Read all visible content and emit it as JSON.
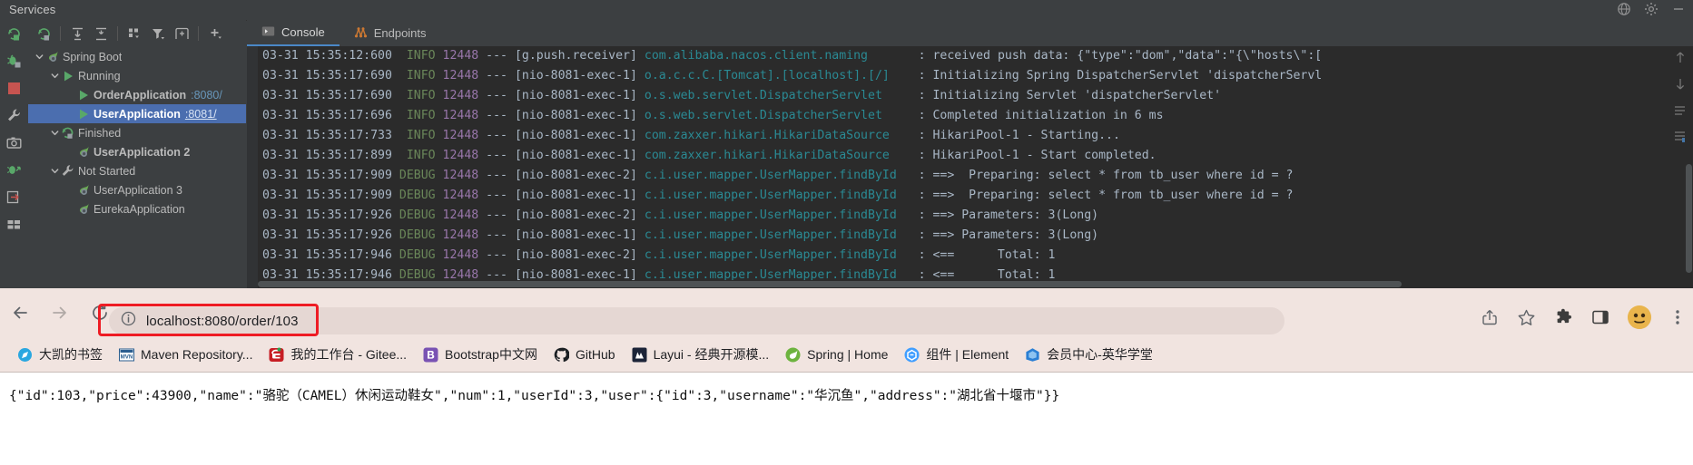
{
  "ide": {
    "window_title": "Services",
    "tree_toolbar_icons": [
      "rerun-icon",
      "expand-all-icon",
      "collapse-all-icon",
      "group-by-icon",
      "filter-icon",
      "add-tab-icon",
      "add-service-icon"
    ],
    "left_strip_icons": [
      "rerun-icon",
      "debug-icon",
      "stop-icon",
      "settings-wrench-icon",
      "camera-icon",
      "debug-attach-icon",
      "export-icon",
      "layout-icon"
    ],
    "tabs": [
      {
        "label": "Console",
        "icon": "console-icon",
        "active": true
      },
      {
        "label": "Endpoints",
        "icon": "endpoints-icon",
        "active": false
      }
    ],
    "tree": [
      {
        "label": "Spring Boot",
        "icon": "spring-icon",
        "indent": 0,
        "arrow": "down",
        "bold": false,
        "selected": false,
        "port": ""
      },
      {
        "label": "Running",
        "icon": "run-icon",
        "indent": 1,
        "arrow": "down",
        "bold": false,
        "selected": false,
        "port": ""
      },
      {
        "label": "OrderApplication",
        "icon": "run-icon",
        "indent": 2,
        "arrow": "none",
        "bold": true,
        "selected": false,
        "port": ":8080/"
      },
      {
        "label": "UserApplication",
        "icon": "run-icon",
        "indent": 2,
        "arrow": "none",
        "bold": true,
        "selected": true,
        "port": ":8081/"
      },
      {
        "label": "Finished",
        "icon": "rerun-icon",
        "indent": 1,
        "arrow": "down",
        "bold": false,
        "selected": false,
        "port": ""
      },
      {
        "label": "UserApplication 2",
        "icon": "spring-icon",
        "indent": 2,
        "arrow": "none",
        "bold": true,
        "selected": false,
        "port": ""
      },
      {
        "label": "Not Started",
        "icon": "wrench-icon",
        "indent": 1,
        "arrow": "down",
        "bold": false,
        "selected": false,
        "port": ""
      },
      {
        "label": "UserApplication 3",
        "icon": "spring-icon",
        "indent": 2,
        "arrow": "none",
        "bold": false,
        "selected": false,
        "port": ""
      },
      {
        "label": "EurekaApplication",
        "icon": "spring-icon",
        "indent": 2,
        "arrow": "none",
        "bold": false,
        "selected": false,
        "port": ""
      }
    ],
    "log_lines": [
      {
        "date": "03-31 15:35:12:600",
        "level": "INFO",
        "pid": "12448",
        "thread": "[g.push.receiver]",
        "logger": "com.alibaba.nacos.client.naming",
        "msg": "received push data: {\"type\":\"dom\",\"data\":\"{\\\"hosts\\\":["
      },
      {
        "date": "03-31 15:35:17:690",
        "level": "INFO",
        "pid": "12448",
        "thread": "[nio-8081-exec-1]",
        "logger": "o.a.c.c.C.[Tomcat].[localhost].[/]",
        "msg": "Initializing Spring DispatcherServlet 'dispatcherServl"
      },
      {
        "date": "03-31 15:35:17:690",
        "level": "INFO",
        "pid": "12448",
        "thread": "[nio-8081-exec-1]",
        "logger": "o.s.web.servlet.DispatcherServlet",
        "msg": "Initializing Servlet 'dispatcherServlet'"
      },
      {
        "date": "03-31 15:35:17:696",
        "level": "INFO",
        "pid": "12448",
        "thread": "[nio-8081-exec-1]",
        "logger": "o.s.web.servlet.DispatcherServlet",
        "msg": "Completed initialization in 6 ms"
      },
      {
        "date": "03-31 15:35:17:733",
        "level": "INFO",
        "pid": "12448",
        "thread": "[nio-8081-exec-1]",
        "logger": "com.zaxxer.hikari.HikariDataSource",
        "msg": "HikariPool-1 - Starting..."
      },
      {
        "date": "03-31 15:35:17:899",
        "level": "INFO",
        "pid": "12448",
        "thread": "[nio-8081-exec-1]",
        "logger": "com.zaxxer.hikari.HikariDataSource",
        "msg": "HikariPool-1 - Start completed."
      },
      {
        "date": "03-31 15:35:17:909",
        "level": "DEBUG",
        "pid": "12448",
        "thread": "[nio-8081-exec-2]",
        "logger": "c.i.user.mapper.UserMapper.findById",
        "msg": "==>  Preparing: select * from tb_user where id = ?"
      },
      {
        "date": "03-31 15:35:17:909",
        "level": "DEBUG",
        "pid": "12448",
        "thread": "[nio-8081-exec-1]",
        "logger": "c.i.user.mapper.UserMapper.findById",
        "msg": "==>  Preparing: select * from tb_user where id = ?"
      },
      {
        "date": "03-31 15:35:17:926",
        "level": "DEBUG",
        "pid": "12448",
        "thread": "[nio-8081-exec-2]",
        "logger": "c.i.user.mapper.UserMapper.findById",
        "msg": "==> Parameters: 3(Long)"
      },
      {
        "date": "03-31 15:35:17:926",
        "level": "DEBUG",
        "pid": "12448",
        "thread": "[nio-8081-exec-1]",
        "logger": "c.i.user.mapper.UserMapper.findById",
        "msg": "==> Parameters: 3(Long)"
      },
      {
        "date": "03-31 15:35:17:946",
        "level": "DEBUG",
        "pid": "12448",
        "thread": "[nio-8081-exec-2]",
        "logger": "c.i.user.mapper.UserMapper.findById",
        "msg": "<==      Total: 1"
      },
      {
        "date": "03-31 15:35:17:946",
        "level": "DEBUG",
        "pid": "12448",
        "thread": "[nio-8081-exec-1]",
        "logger": "c.i.user.mapper.UserMapper.findById",
        "msg": "<==      Total: 1"
      }
    ]
  },
  "browser": {
    "nav": {
      "back_icon": "back-arrow-icon",
      "forward_icon": "forward-arrow-icon",
      "reload_icon": "reload-icon",
      "info_icon": "site-info-icon",
      "url": "localhost:8080/order/103",
      "url_host": "localhost:8080",
      "url_path": "/order/103",
      "highlight_color": "#ee1c24",
      "right_icons": [
        "share-icon",
        "bookmark-star-icon",
        "extensions-puzzle-icon",
        "side-panel-icon",
        "profile-avatar",
        "more-menu-icon"
      ]
    },
    "bookmarks": [
      {
        "label": "大凯的书签",
        "icon": "compass-icon"
      },
      {
        "label": "Maven Repository...",
        "icon": "maven-icon"
      },
      {
        "label": "我的工作台 - Gitee...",
        "icon": "gitee-icon"
      },
      {
        "label": "Bootstrap中文网",
        "icon": "bootstrap-icon"
      },
      {
        "label": "GitHub",
        "icon": "github-icon"
      },
      {
        "label": "Layui - 经典开源模...",
        "icon": "layui-icon"
      },
      {
        "label": "Spring | Home",
        "icon": "spring-leaf-icon"
      },
      {
        "label": "组件 | Element",
        "icon": "element-icon"
      },
      {
        "label": "会员中心-英华学堂",
        "icon": "yinghua-icon"
      }
    ],
    "page_response": "{\"id\":103,\"price\":43900,\"name\":\"骆驼（CAMEL）休闲运动鞋女\",\"num\":1,\"userId\":3,\"user\":{\"id\":3,\"username\":\"华沉鱼\",\"address\":\"湖北省十堰市\"}}"
  }
}
